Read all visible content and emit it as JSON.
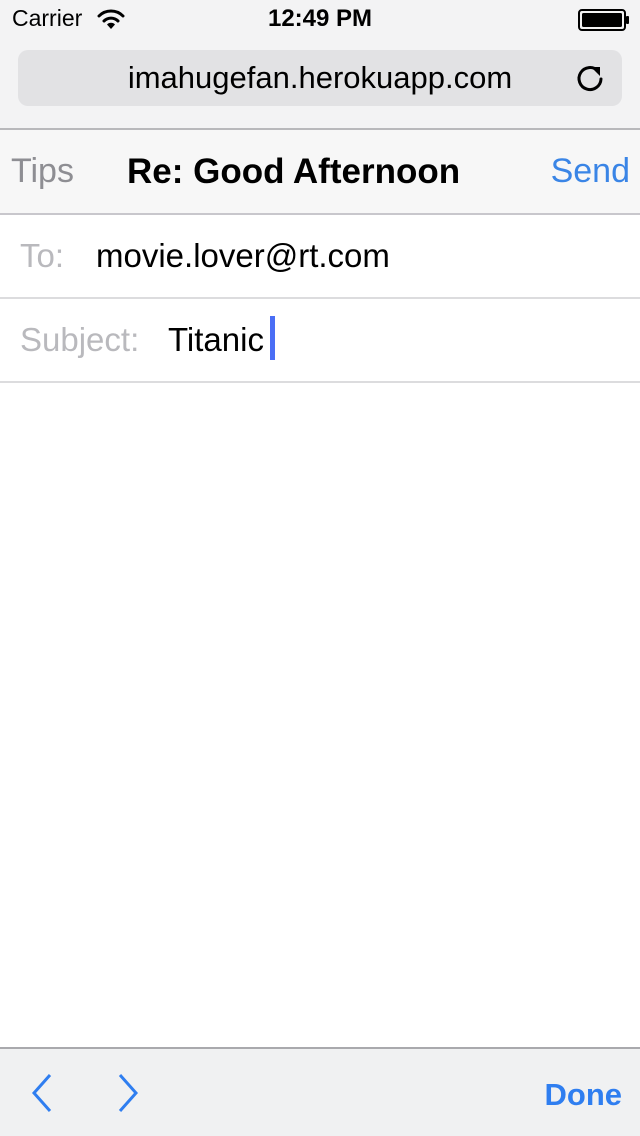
{
  "status_bar": {
    "carrier": "Carrier",
    "time": "12:49 PM",
    "wifi_icon": "wifi-icon",
    "battery_icon": "battery-icon"
  },
  "browser": {
    "url": "imahugefan.herokuapp.com",
    "reload_icon": "reload-icon"
  },
  "compose": {
    "left_button": "Tips",
    "title": "Re: Good Afternoon",
    "right_button": "Send",
    "to_label": "To:",
    "to_value": "movie.lover@rt.com",
    "subject_label": "Subject:",
    "subject_value": "Titanic",
    "body": ""
  },
  "toolbar": {
    "prev_icon": "chevron-left-icon",
    "next_icon": "chevron-right-icon",
    "done_label": "Done"
  },
  "colors": {
    "accent": "#3a85e6",
    "caret": "#4a6ef5",
    "label_gray": "#b9b9bd"
  }
}
